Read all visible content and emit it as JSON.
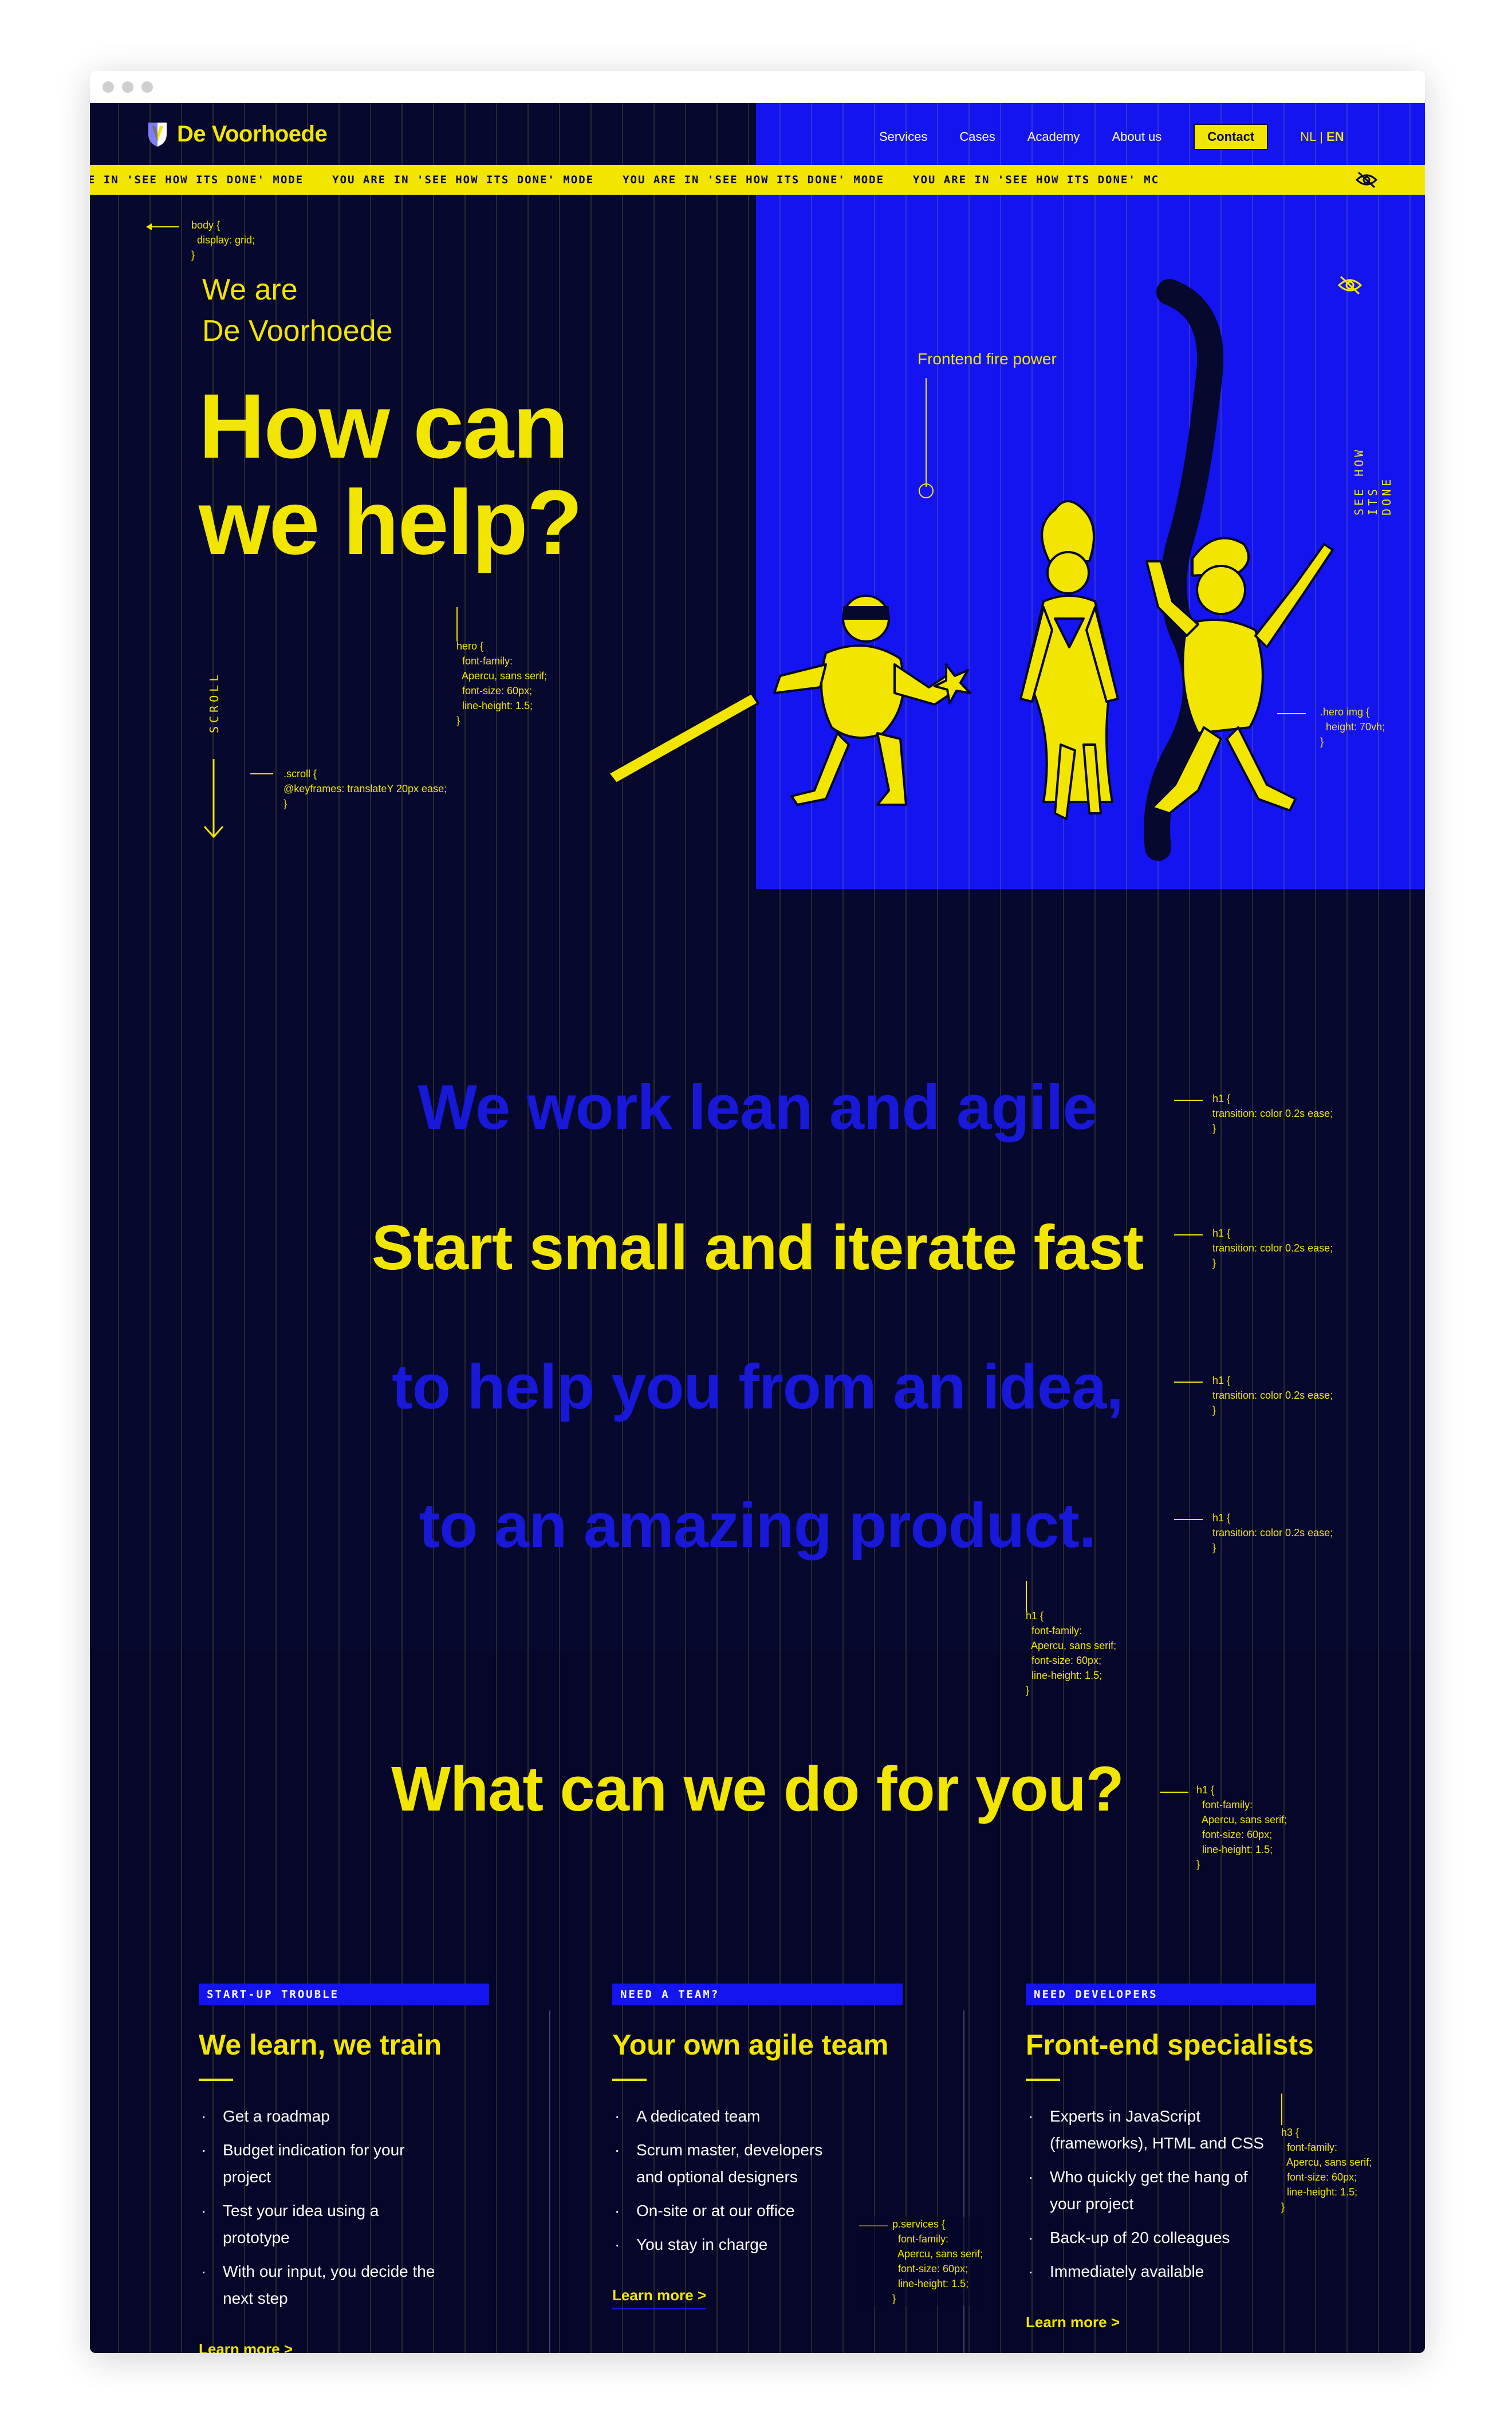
{
  "brand": {
    "name": "De Voorhoede",
    "yellow": "#f2e600",
    "blue": "#1414f0",
    "navy": "#06082e"
  },
  "nav": {
    "links": [
      "Services",
      "Cases",
      "Academy",
      "About us"
    ],
    "contact": "Contact",
    "lang_nl": "NL",
    "lang_sep": "|",
    "lang_en": "EN"
  },
  "ticker": {
    "items": [
      "ARE IN 'SEE HOW ITS DONE' MODE",
      "YOU ARE IN 'SEE HOW ITS DONE' MODE",
      "YOU ARE IN 'SEE HOW ITS DONE' MODE",
      "YOU ARE IN 'SEE HOW ITS DONE' MC"
    ],
    "eye_icon": "eye-slash-icon"
  },
  "hero": {
    "intro_line1": "We are",
    "intro_line2": "De Voorhoede",
    "title_line1": "How can",
    "title_line2": "we help?",
    "scroll_label": "SCROLL",
    "side_label": "SEE HOW ITS DONE",
    "fire_label": "Frontend fire power"
  },
  "code": {
    "body": "body {\n  display: grid;\n}",
    "hero": "hero {\n  font-family:\n  Apercu, sans serif;\n  font-size: 60px;\n  line-height: 1.5;\n}",
    "scroll": ".scroll {\n@keyframes: translateY 20px ease;\n}",
    "heroimg": ".hero img {\n  height: 70vh;\n}",
    "h1_transition_1": "h1 {\ntransition: color 0.2s ease;\n}",
    "h1_transition_2": "h1 {\ntransition: color 0.2s ease;\n}",
    "h1_transition_3": "h1 {\ntransition: color 0.2s ease;\n}",
    "h1_transition_4": "h1 {\ntransition: color 0.2s ease;\n}",
    "h1_font_1": "h1 {\n  font-family:\n  Apercu, sans serif;\n  font-size: 60px;\n  line-height: 1.5;\n}",
    "h1_font_2": "h1 {\n  font-family:\n  Apercu, sans serif;\n  font-size: 60px;\n  line-height: 1.5;\n}",
    "h3_font": "h3 {\n  font-family:\n  Apercu, sans serif;\n  font-size: 60px;\n  line-height: 1.5;\n}",
    "p_services": "p.services {\n  font-family:\n  Apercu, sans serif;\n  font-size: 60px;\n  line-height: 1.5;\n}"
  },
  "statements": [
    "We work lean and agile",
    "Start small and iterate fast",
    "to help you from an idea,",
    "to an amazing product."
  ],
  "services": {
    "title": "What can we do for you?",
    "cards": [
      {
        "badge": "START-UP TROUBLE",
        "title": "We learn, we train",
        "items": [
          "Get a roadmap",
          "Budget indication for your project",
          "Test your idea using a prototype",
          "With our input, you decide the next step"
        ],
        "link": "Learn more  >"
      },
      {
        "badge": "NEED A TEAM?",
        "title": "Your own agile team",
        "items": [
          "A dedicated team",
          "Scrum master, developers and optional designers",
          "On-site or at our office",
          "You stay in charge"
        ],
        "link": "Learn more  >"
      },
      {
        "badge": "NEED DEVELOPERS",
        "title": "Front-end specialists",
        "items": [
          "Experts in JavaScript (frameworks), HTML and CSS",
          "Who quickly get the hang of your project",
          "Back-up of 20 colleagues",
          "Immediately available"
        ],
        "link": "Learn more  >"
      }
    ]
  }
}
